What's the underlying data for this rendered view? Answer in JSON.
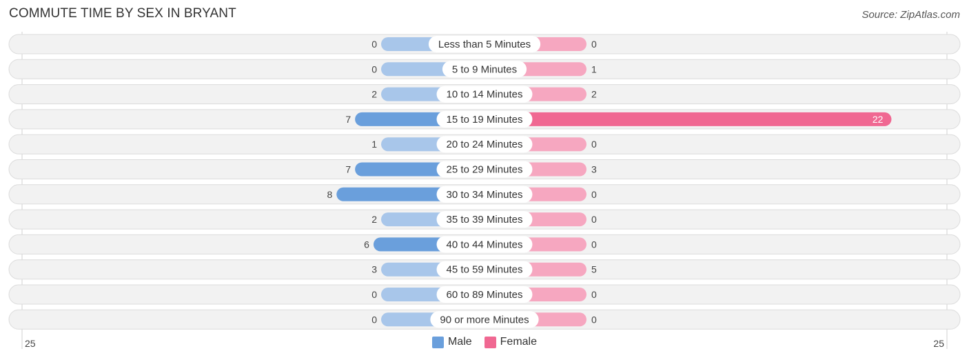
{
  "header": {
    "title": "COMMUTE TIME BY SEX IN BRYANT",
    "source": "Source: ZipAtlas.com"
  },
  "colors": {
    "male_strong": "#6a9fdc",
    "male_light": "#a8c6ea",
    "female_strong": "#f06892",
    "female_light": "#f6a7c0",
    "row_bg": "#f2f2f2",
    "row_border": "#dcdcdc"
  },
  "legend": {
    "male": "Male",
    "female": "Female"
  },
  "chart_data": {
    "type": "bar",
    "orientation": "horizontal-diverging",
    "title": "COMMUTE TIME BY SEX IN BRYANT",
    "categories": [
      "Less than 5 Minutes",
      "5 to 9 Minutes",
      "10 to 14 Minutes",
      "15 to 19 Minutes",
      "20 to 24 Minutes",
      "25 to 29 Minutes",
      "30 to 34 Minutes",
      "35 to 39 Minutes",
      "40 to 44 Minutes",
      "45 to 59 Minutes",
      "60 to 89 Minutes",
      "90 or more Minutes"
    ],
    "series": [
      {
        "name": "Male",
        "values": [
          0,
          0,
          2,
          7,
          1,
          7,
          8,
          2,
          6,
          3,
          0,
          0
        ]
      },
      {
        "name": "Female",
        "values": [
          0,
          1,
          2,
          22,
          0,
          3,
          0,
          0,
          0,
          5,
          0,
          0
        ]
      }
    ],
    "axis": {
      "left_label": "25",
      "right_label": "25",
      "max": 25
    },
    "legend_position": "bottom-center",
    "grid": false
  }
}
